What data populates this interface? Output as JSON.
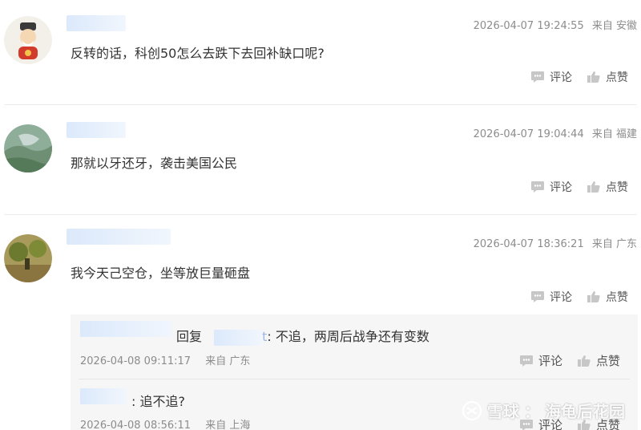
{
  "comments": [
    {
      "text": "反转的话，科创50怎么去跌下去回补缺口呢?",
      "datetime": "2026-04-07 19:24:55",
      "source": "来自 安徽",
      "comment_label": "评论",
      "like_label": "点赞",
      "avatar_icon": "fortune-god-avatar"
    },
    {
      "text": "那就以牙还牙，袭击美国公民",
      "datetime": "2026-04-07 19:04:44",
      "source": "来自 福建",
      "comment_label": "评论",
      "like_label": "点赞",
      "avatar_icon": "landscape-avatar"
    },
    {
      "text": "我今天己空仓，坐等放巨量砸盘",
      "datetime": "2026-04-07 18:36:21",
      "source": "来自 广东",
      "comment_label": "评论",
      "like_label": "点赞",
      "avatar_icon": "forest-avatar"
    }
  ],
  "replies": [
    {
      "reply_word": "回复",
      "tail_char": "t",
      "text": ": 不追，两周后战争还有变数",
      "datetime": "2026-04-08 09:11:17",
      "source": "来自 广东",
      "comment_label": "评论",
      "like_label": "点赞"
    },
    {
      "text": ": 追不追?",
      "datetime": "2026-04-08 08:56:11",
      "source": "来自 上海",
      "comment_label": "评论",
      "like_label": "点赞"
    }
  ],
  "watermark": {
    "brand": "雪球",
    "separator": "：",
    "account": "海龟后花园"
  },
  "colors": {
    "meta_gray": "#8c8c8c",
    "name_blur": "#dbe9fb",
    "reply_bg": "#f6f6f7"
  }
}
